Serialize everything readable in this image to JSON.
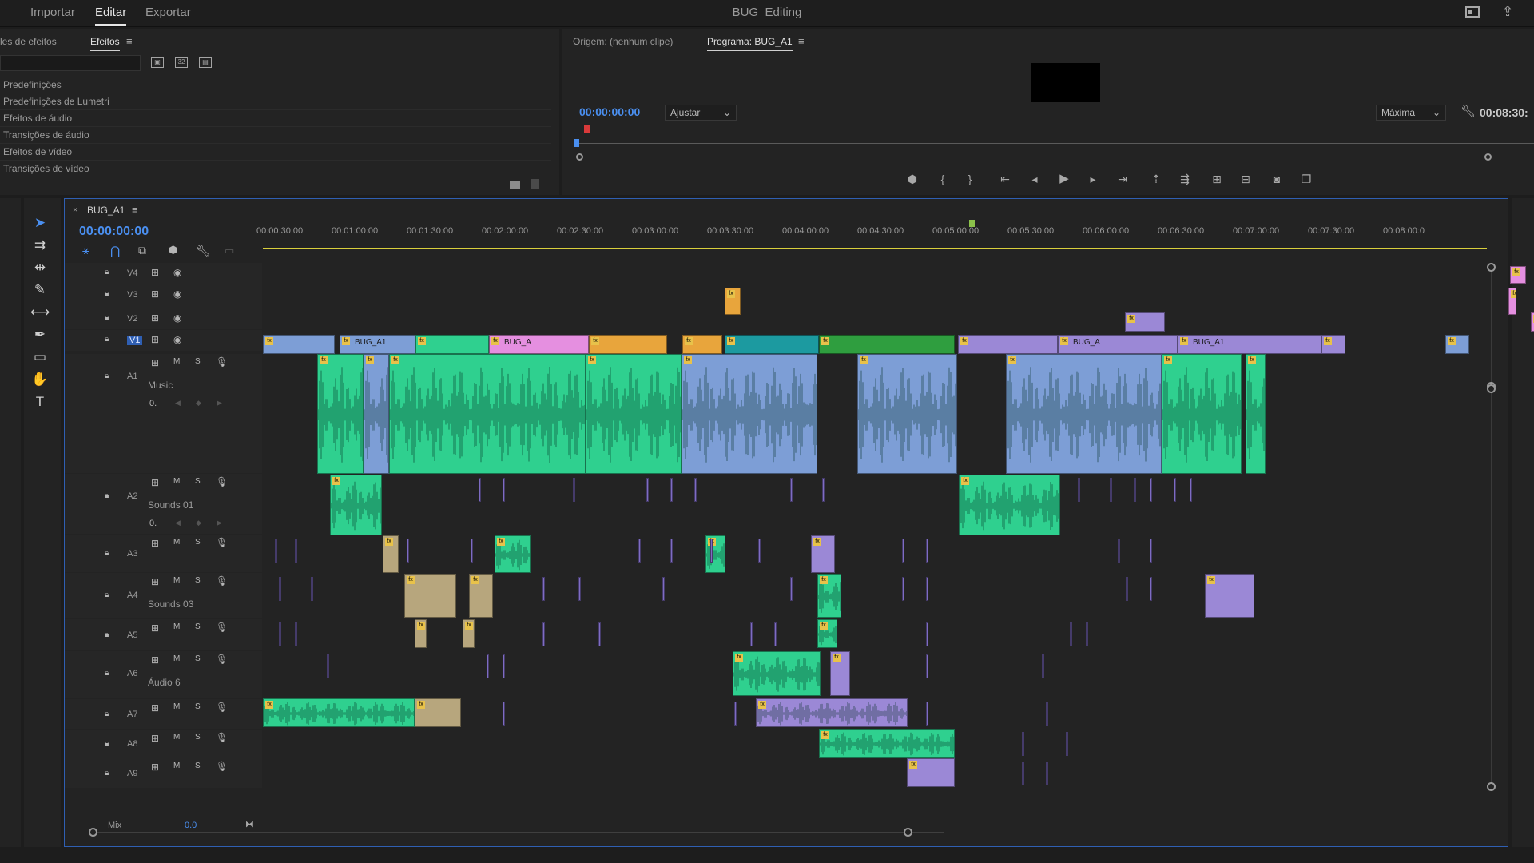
{
  "workspace": {
    "tabs": [
      "Importar",
      "Editar",
      "Exportar"
    ],
    "active_tab": "Editar",
    "title": "BUG_Editing"
  },
  "effects_panel": {
    "tab_controls": "les de efeitos",
    "tab_effects": "Efeitos",
    "items": [
      "Predefinições",
      "Predefinições de Lumetri",
      "Efeitos de áudio",
      "Transições de áudio",
      "Efeitos de vídeo",
      "Transições de vídeo"
    ]
  },
  "program_monitor": {
    "source_tab": "Origem: (nenhum clipe)",
    "program_tab": "Programa: BUG_A1",
    "timecode": "00:00:00:00",
    "fit": "Ajustar",
    "quality": "Máxima",
    "duration": "00:08:30:"
  },
  "timeline": {
    "sequence_name": "BUG_A1",
    "timecode": "00:00:00:00",
    "ruler": [
      "00:00:30:00",
      "00:01:00:00",
      "00:01:30:00",
      "00:02:00:00",
      "00:02:30:00",
      "00:03:00:00",
      "00:03:30:00",
      "00:04:00:00",
      "00:04:30:00",
      "00:05:00:00",
      "00:05:30:00",
      "00:06:00:00",
      "00:06:30:00",
      "00:07:00:00",
      "00:07:30:00",
      "00:08:00:0"
    ],
    "video_tracks": [
      "V4",
      "V3",
      "V2",
      "V1"
    ],
    "audio_tracks": [
      {
        "id": "A1",
        "name": "Music"
      },
      {
        "id": "A2",
        "name": "Sounds 01"
      },
      {
        "id": "A3",
        "name": ""
      },
      {
        "id": "A4",
        "name": "Sounds 03"
      },
      {
        "id": "A5",
        "name": ""
      },
      {
        "id": "A6",
        "name": "Áudio 6"
      },
      {
        "id": "A7",
        "name": ""
      },
      {
        "id": "A8",
        "name": ""
      },
      {
        "id": "A9",
        "name": ""
      }
    ],
    "mix_label": "Mix",
    "mix_value": "0.0",
    "track_buttons": {
      "mute": "M",
      "solo": "S",
      "volume": "0."
    },
    "clip_labels": {
      "v1_a": "BUG_A1",
      "v1_b": "BUG_A",
      "v1_c": "BUG_A",
      "v1_d": "BUG_A1"
    }
  },
  "colors": {
    "accent_blue": "#4a8ff0",
    "clip_blue": "#7d9ed6",
    "clip_green": "#2fd08f",
    "clip_pink": "#e58fe0",
    "clip_orange": "#e8a53c",
    "clip_purple": "#9b88d6",
    "clip_teal": "#1c9aa0",
    "clip_darkgreen": "#2f9e3f",
    "clip_tan": "#b7a67d"
  }
}
